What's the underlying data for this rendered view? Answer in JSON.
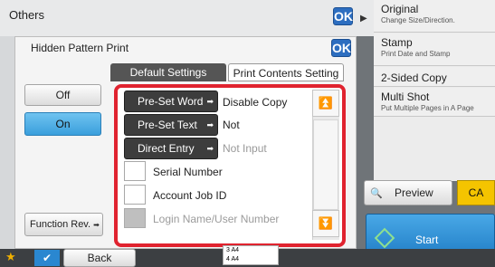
{
  "background": {
    "title": "Others",
    "ok_label": "OK",
    "right_menu": [
      {
        "title": "Original",
        "sub": "Change Size/Direction."
      },
      {
        "title": "Stamp",
        "sub": "Print Date and Stamp"
      },
      {
        "title": "2-Sided Copy",
        "sub": ""
      },
      {
        "title": "Multi Shot",
        "sub": "Put Multiple Pages in A Page"
      }
    ],
    "preview_label": "Preview",
    "ca_label": "CA",
    "start_label": "Start",
    "back_label": "Back",
    "tray_rows": [
      "3   A4",
      "4   A4"
    ]
  },
  "dialog": {
    "title": "Hidden Pattern Print",
    "ok_label": "OK",
    "tabs": [
      "Default Settings",
      "Print Contents Setting"
    ],
    "off_label": "Off",
    "on_label": "On",
    "function_rev_label": "Function Rev.",
    "rows": [
      {
        "button": "Pre-Set Word",
        "value": "Disable Copy"
      },
      {
        "button": "Pre-Set Text",
        "value": "Not"
      },
      {
        "button": "Direct Entry",
        "value": "Not Input"
      }
    ],
    "checks": [
      "Serial Number",
      "Account Job ID",
      "Login Name/User Number"
    ]
  }
}
